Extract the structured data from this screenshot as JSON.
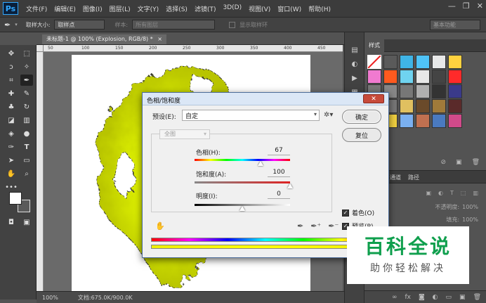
{
  "app": {
    "logo": "Ps"
  },
  "menu": [
    "文件(F)",
    "编辑(E)",
    "图像(I)",
    "图层(L)",
    "文字(Y)",
    "选择(S)",
    "滤镜(T)",
    "3D(D)",
    "视图(V)",
    "窗口(W)",
    "帮助(H)"
  ],
  "window_controls": {
    "minimize": "—",
    "restore": "❐",
    "close": "✕"
  },
  "options": {
    "sample_size_label": "取样大小:",
    "sample_size_value": "取样点",
    "sample_label": "样本:",
    "sample_value": "所有图层",
    "show_ring": "显示取样环",
    "workspace": "基本功能"
  },
  "document": {
    "tab": "未标题-1 @ 100% (Explosion, RGB/8) *",
    "tab_close": "×",
    "zoom": "100%",
    "doc_info": "文档:675.0K/900.0K",
    "ruler_ticks": [
      "50",
      "100",
      "150",
      "200",
      "250",
      "300",
      "350",
      "400",
      "450",
      "500"
    ]
  },
  "styles_panel": {
    "tab": "样式",
    "swatch_colors": [
      "#ffffff",
      "#5a5a5a",
      "#3fb4e6",
      "#4fc3f7",
      "#e8e8e8",
      "#ffd23f",
      "#f07ad0",
      "#ff5a1f",
      "#6fd3f0",
      "#e8e8e8",
      "#444444",
      "#ff2a2a",
      "#777777",
      "#888888",
      "#777777",
      "#b0b0b0",
      "#333333",
      "#3a3a8a",
      "#a08a6a",
      "#777777",
      "#e0c060",
      "#6a4a2a",
      "#a07a3a",
      "#5a2a2a",
      "#9a7ad0",
      "#f0d040",
      "#7ab0f0",
      "#c07050",
      "#4a7ac0",
      "#d04a8a"
    ]
  },
  "layers_panel": {
    "tabs": [
      "通道",
      "路径"
    ],
    "opacity_label": "不透明度:",
    "opacity_value": "100%",
    "fill_label": "填充:",
    "fill_value": "100%"
  },
  "dialog": {
    "title": "色相/饱和度",
    "close": "✕",
    "preset_label": "预设(E):",
    "preset_value": "自定",
    "ok": "确定",
    "reset": "复位",
    "edit_channel": "全图",
    "hue_label": "色相(H):",
    "hue_value": "67",
    "hue_position": 0.69,
    "saturation_label": "饱和度(A):",
    "saturation_value": "100",
    "saturation_position": 1.0,
    "lightness_label": "明度(I):",
    "lightness_value": "0",
    "lightness_position": 0.5,
    "colorize_label": "着色(O)",
    "colorize_checked": "✓",
    "preview_label": "预览(P)",
    "preview_checked": "✓"
  },
  "watermark": {
    "main": "百科全说",
    "sub": "助你轻松解决",
    "color": "#0f9f4d"
  }
}
